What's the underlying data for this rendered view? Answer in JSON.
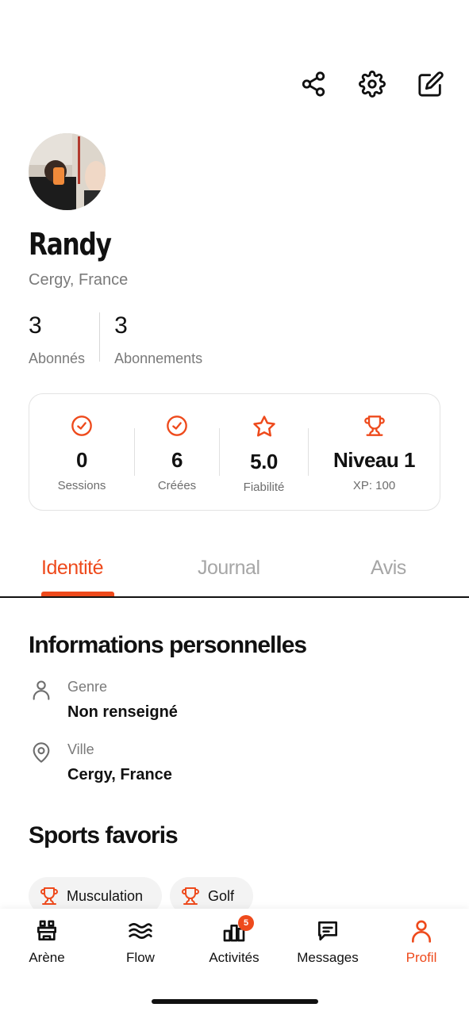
{
  "header": {
    "icons": [
      "share-icon",
      "gear-icon",
      "edit-icon"
    ]
  },
  "profile": {
    "name": "Randy",
    "location": "Cergy, France",
    "followers_count": "3",
    "followers_label": "Abonnés",
    "following_count": "3",
    "following_label": "Abonnements"
  },
  "stats": [
    {
      "icon": "check-circle-icon",
      "value": "0",
      "label": "Sessions"
    },
    {
      "icon": "check-circle-icon",
      "value": "6",
      "label": "Créées"
    },
    {
      "icon": "star-icon",
      "value": "5.0",
      "label": "Fiabilité"
    },
    {
      "icon": "trophy-icon",
      "value": "Niveau 1",
      "label": "XP: 100"
    }
  ],
  "tabs": [
    {
      "label": "Identité",
      "active": true
    },
    {
      "label": "Journal",
      "active": false
    },
    {
      "label": "Avis",
      "active": false
    }
  ],
  "personal_info": {
    "title": "Informations personnelles",
    "rows": [
      {
        "icon": "user-icon",
        "key": "Genre",
        "value": "Non renseigné"
      },
      {
        "icon": "location-pin-icon",
        "key": "Ville",
        "value": "Cergy, France"
      }
    ]
  },
  "sports": {
    "title": "Sports favoris",
    "items": [
      {
        "icon": "trophy-icon",
        "label": "Musculation"
      },
      {
        "icon": "trophy-icon",
        "label": "Golf"
      }
    ]
  },
  "bottom_nav": [
    {
      "icon": "arena-icon",
      "label": "Arène",
      "active": false
    },
    {
      "icon": "waves-icon",
      "label": "Flow",
      "active": false
    },
    {
      "icon": "bar-chart-icon",
      "label": "Activités",
      "active": false,
      "badge": "5"
    },
    {
      "icon": "message-icon",
      "label": "Messages",
      "active": false
    },
    {
      "icon": "user-icon",
      "label": "Profil",
      "active": true
    }
  ],
  "colors": {
    "accent": "#ee4a1c",
    "text": "#111111",
    "muted": "#7a7a7a"
  }
}
